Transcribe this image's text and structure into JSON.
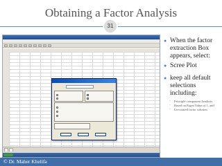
{
  "slide": {
    "title": "Obtaining a Factor Analysis",
    "number": "31",
    "footer": "© Dr. Maher Khelifa"
  },
  "bullets": [
    {
      "level": 1,
      "text": "When the factor extraction Box appears, select:"
    },
    {
      "level": 1,
      "text": "Scree Plot"
    },
    {
      "level": 1,
      "text": "keep all default selections including:"
    },
    {
      "level": 2,
      "text": "Principle component Analysis"
    },
    {
      "level": 2,
      "text": "Based on Eigen Value of 1, and"
    },
    {
      "level": 2,
      "text": "Un-rotated factor solution"
    }
  ],
  "colors": {
    "accent": "#4a86c5",
    "footer_bg": "#3f6fa6",
    "title": "#555555"
  }
}
